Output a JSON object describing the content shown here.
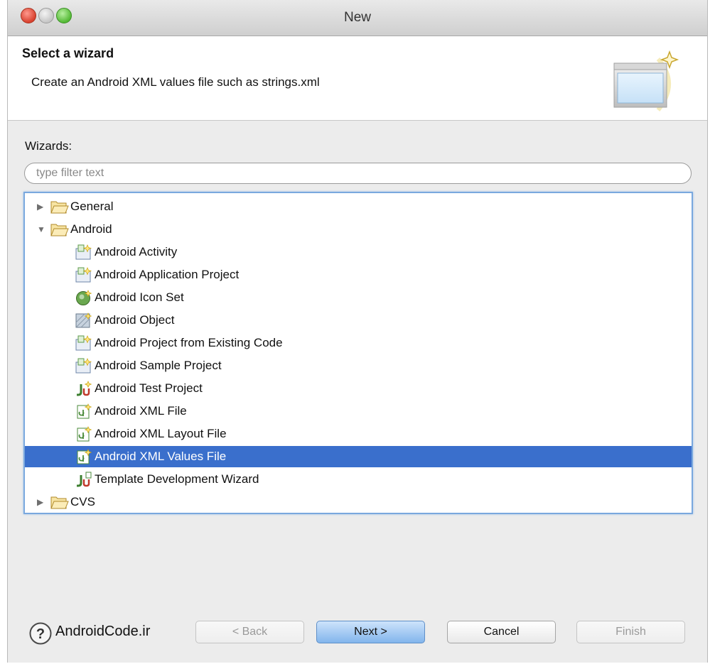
{
  "window": {
    "title": "New"
  },
  "header": {
    "title": "Select a wizard",
    "description": "Create an Android XML values file such as strings.xml",
    "banner_icon": "wizard-banner-icon"
  },
  "wizards_label": "Wizards:",
  "filter": {
    "placeholder": "type filter text",
    "value": ""
  },
  "tree": [
    {
      "label": "General",
      "icon": "folder-icon",
      "expanded": false,
      "level": 0
    },
    {
      "label": "Android",
      "icon": "folder-icon",
      "expanded": true,
      "level": 0
    },
    {
      "label": "Android Activity",
      "icon": "android-project-icon",
      "level": 1
    },
    {
      "label": "Android Application Project",
      "icon": "android-project-icon",
      "level": 1
    },
    {
      "label": "Android Icon Set",
      "icon": "android-icon-set-icon",
      "level": 1
    },
    {
      "label": "Android Object",
      "icon": "android-object-icon",
      "level": 1
    },
    {
      "label": "Android Project from Existing Code",
      "icon": "android-project-icon",
      "level": 1
    },
    {
      "label": "Android Sample Project",
      "icon": "android-project-icon",
      "level": 1
    },
    {
      "label": "Android Test Project",
      "icon": "junit-icon",
      "level": 1
    },
    {
      "label": "Android XML File",
      "icon": "android-xml-icon",
      "level": 1
    },
    {
      "label": "Android XML Layout File",
      "icon": "android-xml-icon",
      "level": 1
    },
    {
      "label": "Android XML Values File",
      "icon": "android-xml-icon",
      "level": 1,
      "selected": true
    },
    {
      "label": "Template Development Wizard",
      "icon": "junit-icon",
      "level": 1
    },
    {
      "label": "CVS",
      "icon": "folder-icon",
      "expanded": false,
      "level": 0
    }
  ],
  "footer": {
    "brand": "AndroidCode.ir",
    "back": "< Back",
    "next": "Next >",
    "cancel": "Cancel",
    "finish": "Finish"
  },
  "colors": {
    "selection": "#3a6fcc",
    "tree_border": "#7aa8de"
  }
}
